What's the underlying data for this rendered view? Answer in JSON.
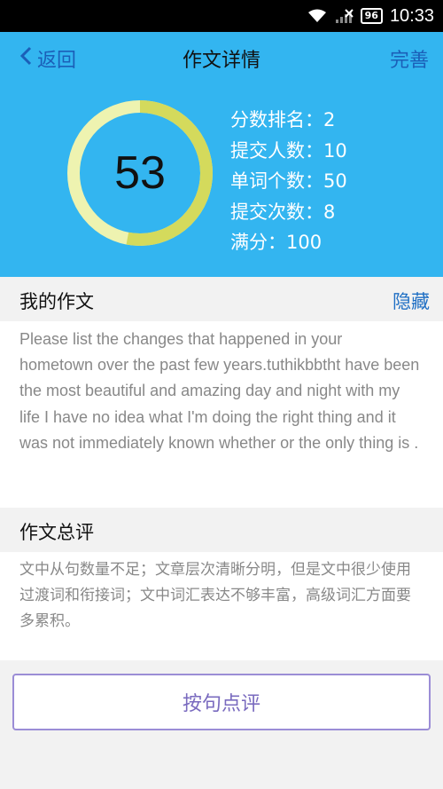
{
  "status_bar": {
    "time": "10:33",
    "battery": "96"
  },
  "nav": {
    "back_label": "返回",
    "title": "作文详情",
    "done_label": "完善"
  },
  "score": {
    "value": "53",
    "percent": 53,
    "colors": {
      "filled": "#d4da5c",
      "remaining": "#eef3b0"
    }
  },
  "stats": [
    "分数排名：2",
    "提交人数：10",
    "单词个数：50",
    "提交次数：8",
    "满分：100"
  ],
  "essay": {
    "title": "我的作文",
    "hide_label": "隐藏",
    "text": "Please list the changes that happened in your hometown over the past few years.tuthikbbtht have been the most beautiful and amazing day and night with my life I have no idea what I'm doing the right thing and it was not immediately known whether or the only thing is ."
  },
  "review": {
    "title": "作文总评",
    "text": "文中从句数量不足；文章层次清晰分明，但是文中很少使用过渡词和衔接词；文中词汇表达不够丰富，高级词汇方面要多累积。"
  },
  "action_button": {
    "label": "按句点评"
  },
  "colors": {
    "header": "#33b5f0",
    "link": "#1b5fb8",
    "button_border": "#9b8dd6"
  }
}
